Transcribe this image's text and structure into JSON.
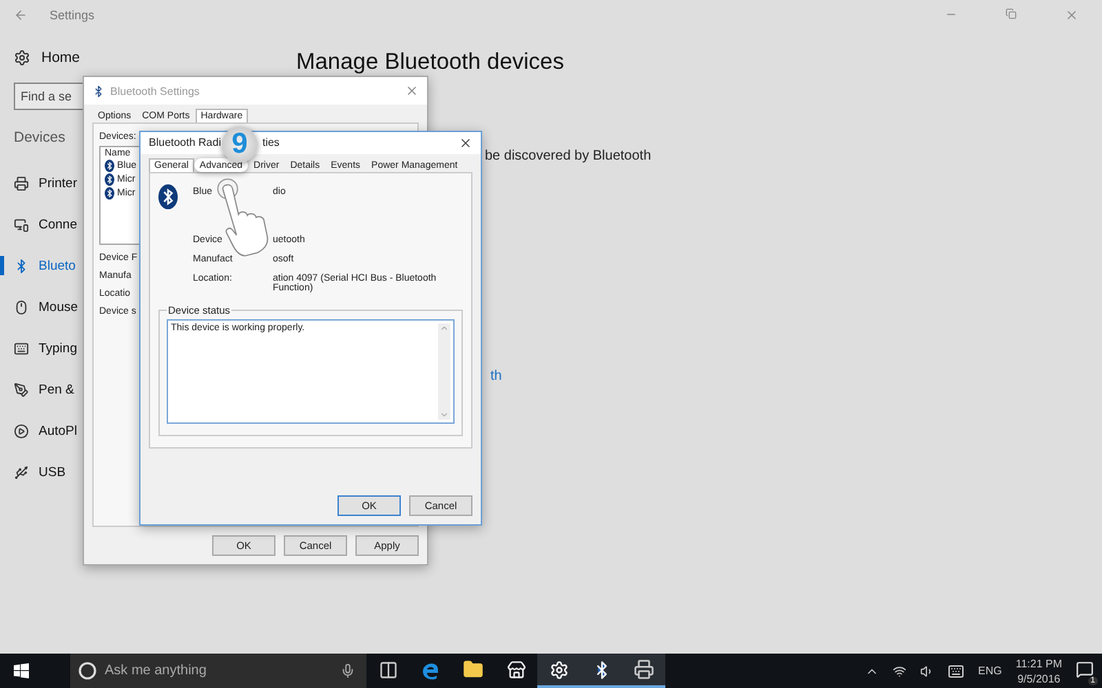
{
  "window": {
    "title": "Settings"
  },
  "sidebar": {
    "home": "Home",
    "search": {
      "placeholder": "Find a se"
    },
    "section": "Devices",
    "items": [
      {
        "label": "Printer",
        "selected": false
      },
      {
        "label": "Conne",
        "selected": false
      },
      {
        "label": "Blueto",
        "selected": true
      },
      {
        "label": "Mouse",
        "selected": false
      },
      {
        "label": "Typing",
        "selected": false
      },
      {
        "label": "Pen &",
        "selected": false
      },
      {
        "label": "AutoPl",
        "selected": false
      },
      {
        "label": "USB",
        "selected": false
      }
    ]
  },
  "main": {
    "heading": "Manage Bluetooth devices",
    "discover_text": "be discovered by Bluetooth",
    "link": "th"
  },
  "bt_settings": {
    "title": "Bluetooth Settings",
    "tabs": [
      {
        "label": "Options",
        "selected": false
      },
      {
        "label": "COM Ports",
        "selected": false
      },
      {
        "label": "Hardware",
        "selected": true
      }
    ],
    "devices_label": "Devices:",
    "list_header": "Name",
    "devices": [
      "Blue",
      "Micr",
      "Micr"
    ],
    "fields": [
      "Device F",
      "Manufa",
      "Locatio",
      "Device s"
    ],
    "buttons": [
      "OK",
      "Cancel",
      "Apply"
    ]
  },
  "radio_props": {
    "title_parts": [
      "Bluetooth Radi",
      "ties"
    ],
    "tabs": [
      {
        "label": "General",
        "selected": true,
        "highlighted": false
      },
      {
        "label": "Advanced",
        "selected": false,
        "highlighted": true
      },
      {
        "label": "Driver",
        "selected": false,
        "highlighted": false
      },
      {
        "label": "Details",
        "selected": false,
        "highlighted": false
      },
      {
        "label": "Events",
        "selected": false,
        "highlighted": false
      },
      {
        "label": "Power Management",
        "selected": false,
        "highlighted": false
      }
    ],
    "name_parts": [
      "Blue",
      "dio"
    ],
    "rows": [
      {
        "label": "Device",
        "value": "uetooth"
      },
      {
        "label": "Manufact",
        "value": "osoft"
      },
      {
        "label": "Location:",
        "value": "ation 4097 (Serial HCI Bus - Bluetooth Function)"
      }
    ],
    "status_label": "Device status",
    "status_text": "This device is working properly.",
    "buttons": [
      {
        "label": "OK",
        "default": true
      },
      {
        "label": "Cancel",
        "default": false
      }
    ]
  },
  "tutorial": {
    "step": "9"
  },
  "taskbar": {
    "search_placeholder": "Ask me anything",
    "apps": [
      {
        "kind": "task-view",
        "running": false
      },
      {
        "kind": "edge",
        "running": false
      },
      {
        "kind": "explorer",
        "running": false
      },
      {
        "kind": "store",
        "running": false
      },
      {
        "kind": "settings",
        "running": true
      },
      {
        "kind": "bluetooth",
        "running": true
      },
      {
        "kind": "printer",
        "running": true
      }
    ],
    "language": "ENG",
    "time": "11:21 PM",
    "date": "9/5/2016",
    "notifications": "1"
  }
}
